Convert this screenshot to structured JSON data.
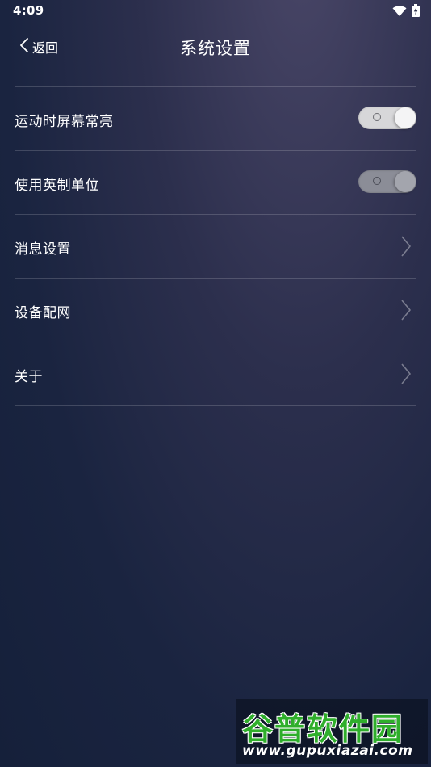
{
  "status_bar": {
    "time": "4:09",
    "icons": [
      "wifi-icon",
      "battery-charging-icon"
    ]
  },
  "header": {
    "back_label": "返回",
    "title": "系统设置"
  },
  "settings": {
    "items": [
      {
        "label": "运动时屏幕常亮",
        "control": "toggle",
        "state": "off"
      },
      {
        "label": "使用英制单位",
        "control": "toggle",
        "state": "off"
      },
      {
        "label": "消息设置",
        "control": "chevron"
      },
      {
        "label": "设备配网",
        "control": "chevron"
      },
      {
        "label": "关于",
        "control": "chevron"
      }
    ]
  },
  "watermark": {
    "logo_text": "谷普软件园",
    "url": "www.gupuxiazai.com"
  },
  "colors": {
    "background_top": "#4a4768",
    "background_bottom": "#15203a",
    "divider": "rgba(255,255,255,0.17)",
    "watermark_green": "#2fae2b"
  }
}
